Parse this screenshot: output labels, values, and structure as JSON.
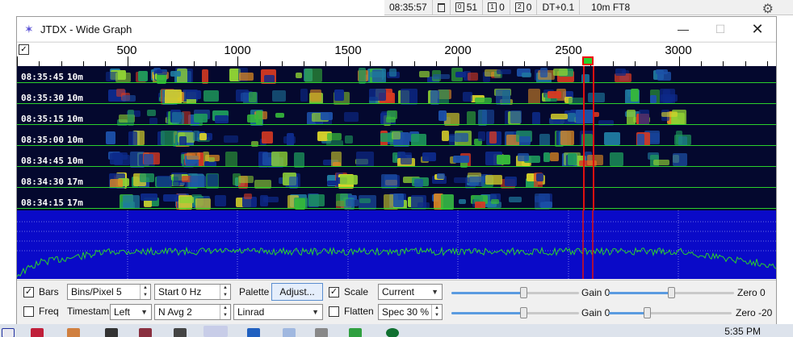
{
  "status": {
    "time": "08:35:57",
    "count_a": "51",
    "count_b_box": "1",
    "count_b": "0",
    "count_c_box": "2",
    "count_c": "0",
    "box_a": "0",
    "dt": "DT+0.1",
    "mode": "10m FT8"
  },
  "window": {
    "title": "JTDX - Wide Graph",
    "minimize": "—",
    "maximize": "☐",
    "close": "✕"
  },
  "scale": {
    "checkbox": "✓",
    "labels": [
      "500",
      "1000",
      "1500",
      "2000",
      "2500",
      "3000"
    ]
  },
  "waterfall": {
    "rows": [
      {
        "time": "08:35:45",
        "band": "10m"
      },
      {
        "time": "08:35:30",
        "band": "10m"
      },
      {
        "time": "08:35:15",
        "band": "10m"
      },
      {
        "time": "08:35:00",
        "band": "10m"
      },
      {
        "time": "08:34:45",
        "band": "10m"
      },
      {
        "time": "08:34:30",
        "band": "17m"
      },
      {
        "time": "08:34:15",
        "band": "17m"
      }
    ]
  },
  "controls": {
    "bars_label": "Bars",
    "bars_checked": "✓",
    "freq_label": "Freq",
    "bins_label": "Bins/Pixel  5",
    "start_label": "Start 0 Hz",
    "timestamp_label": "Timestamp",
    "timestamp_value": "Left",
    "navg_label": "N Avg 2",
    "palette_label": "Palette",
    "adjust_button": "Adjust...",
    "palette_value": "Linrad",
    "scale_label": "Scale",
    "scale_checked": "✓",
    "flatten_label": "Flatten",
    "current_value": "Current",
    "spec_label": "Spec 30 %",
    "gain1_label": "Gain 0",
    "zero1_label": "Zero 0",
    "gain2_label": "Gain 0",
    "zero2_label": "Zero -20",
    "sliders": {
      "wf_gain": 0.57,
      "wf_zero": 0.5,
      "spec_gain": 0.57,
      "spec_zero": 0.3
    }
  },
  "taskbar": {
    "time": "5:35 PM"
  }
}
